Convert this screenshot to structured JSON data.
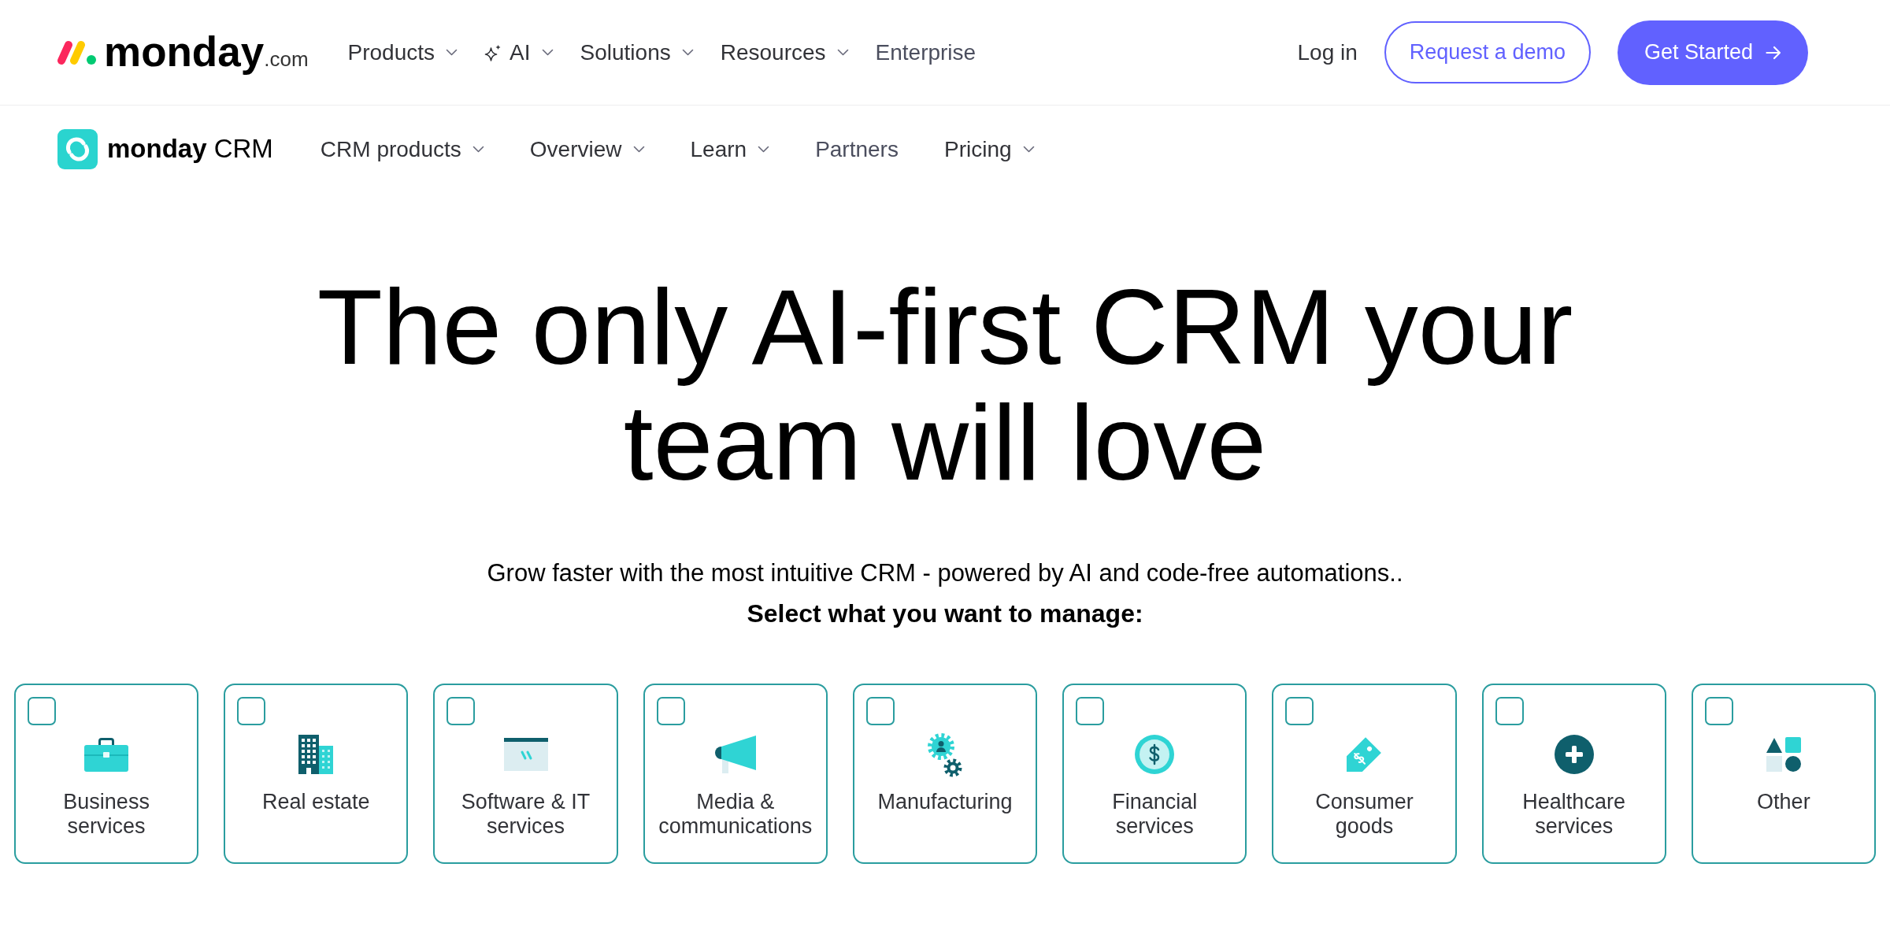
{
  "top_nav": {
    "logo": {
      "brand": "monday",
      "suffix": ".com"
    },
    "items": [
      {
        "label": "Products",
        "kind": "menu"
      },
      {
        "label": "AI",
        "kind": "ai-menu"
      },
      {
        "label": "Solutions",
        "kind": "menu"
      },
      {
        "label": "Resources",
        "kind": "menu"
      },
      {
        "label": "Enterprise",
        "kind": "link"
      }
    ],
    "actions": [
      {
        "label": "Log in",
        "kind": "text"
      },
      {
        "label": "Request a demo",
        "kind": "outline"
      },
      {
        "label": "Get Started",
        "kind": "primary"
      }
    ]
  },
  "product_nav": {
    "logo": {
      "brand": "monday",
      "product": "CRM"
    },
    "items": [
      {
        "label": "CRM products",
        "kind": "menu"
      },
      {
        "label": "Overview",
        "kind": "menu"
      },
      {
        "label": "Learn",
        "kind": "menu"
      },
      {
        "label": "Partners",
        "kind": "link"
      },
      {
        "label": "Pricing",
        "kind": "menu"
      }
    ]
  },
  "hero": {
    "title": "The only AI-first CRM your team will love",
    "subtitle": "Grow faster with the most intuitive CRM - powered by AI and code-free automations..",
    "prompt": "Select what you want to manage:"
  },
  "categories": [
    {
      "label": "Business services",
      "checked": false
    },
    {
      "label": "Real estate",
      "checked": false
    },
    {
      "label": "Software & IT services",
      "checked": false
    },
    {
      "label": "Media & communications",
      "checked": false
    },
    {
      "label": "Manufacturing",
      "checked": false
    },
    {
      "label": "Financial services",
      "checked": false
    },
    {
      "label": "Consumer goods",
      "checked": false
    },
    {
      "label": "Healthcare services",
      "checked": false
    },
    {
      "label": "Other",
      "checked": false
    }
  ]
}
